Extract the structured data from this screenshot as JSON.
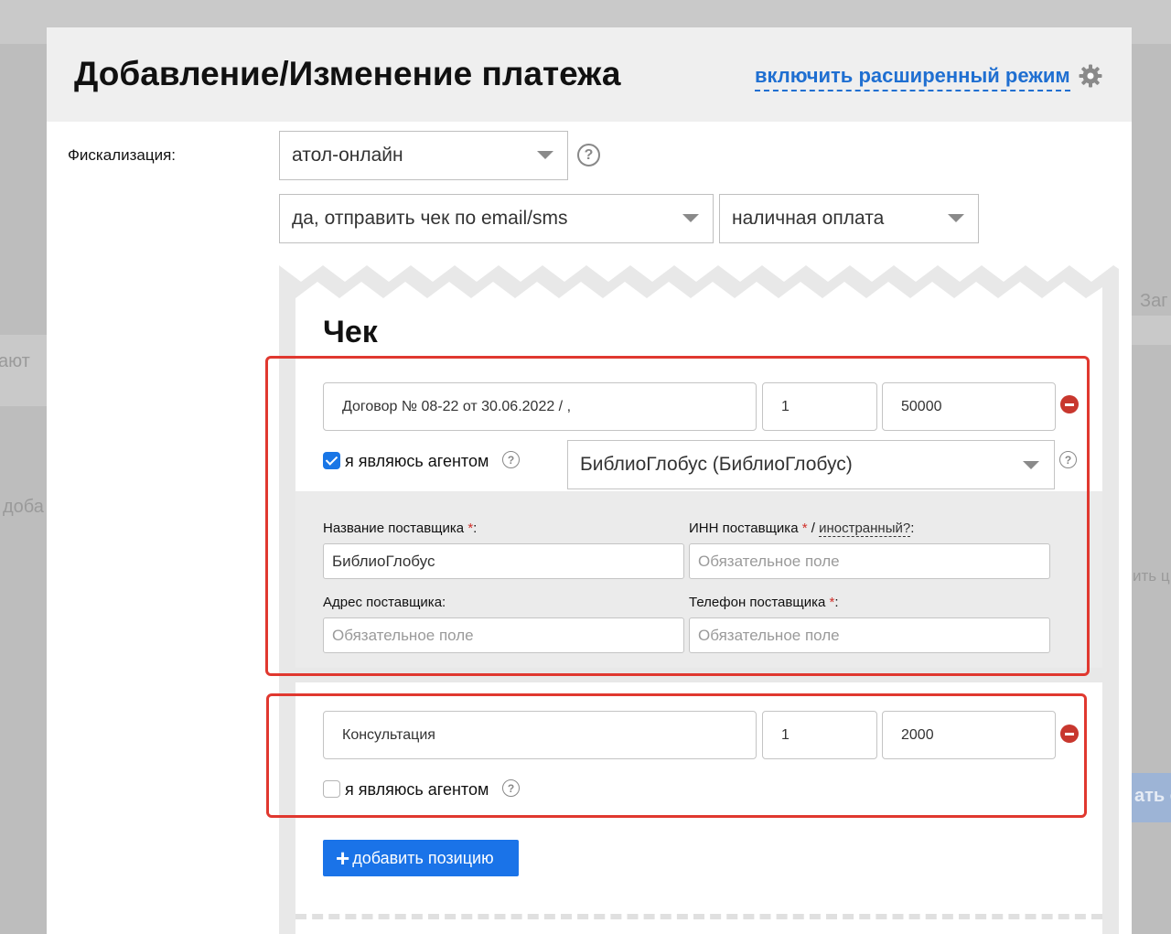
{
  "background": {
    "left_text_1": "ают",
    "left_text_2": "доба",
    "right_text_1": "Заг",
    "right_text_2": "ить ц",
    "right_button": "ать с"
  },
  "modal": {
    "title": "Добавление/Изменение платежа",
    "advanced_mode_link": "включить расширенный режим"
  },
  "fiscal": {
    "label": "Фискализация:",
    "provider_selected": "атол-онлайн",
    "send_receipt_selected": "да, отправить чек по email/sms",
    "payment_type_selected": "наличная оплата",
    "help_mark": "?"
  },
  "receipt": {
    "title": "Чек",
    "positions": [
      {
        "name": "Договор № 08-22 от 30.06.2022 / ,",
        "quantity": "1",
        "price": "50000",
        "agent_label": "я являюсь агентом",
        "agent_checked": true,
        "supplier_selected": "БиблиоГлобус (БиблиоГлобус)"
      },
      {
        "name": "Консультация",
        "quantity": "1",
        "price": "2000",
        "agent_label": "я являюсь агентом",
        "agent_checked": false
      }
    ],
    "supplier_form": {
      "name_label": "Название поставщика ",
      "name_value": "БиблиоГлобус",
      "inn_label": "ИНН поставщика ",
      "inn_slash": " / ",
      "inn_foreign": "иностранный?",
      "inn_colon": ":",
      "inn_placeholder": "Обязательное поле",
      "address_label": "Адрес поставщика:",
      "address_placeholder": "Обязательное поле",
      "phone_label": "Телефон поставщика ",
      "phone_placeholder": "Обязательное поле",
      "required_mark": "*",
      "label_colon": ":"
    },
    "add_position_button": "добавить позицию",
    "add_position_plus": "+"
  },
  "colors": {
    "accent_blue": "#1a73e8",
    "link_blue": "#1f6fd1",
    "remove_red": "#c8372e",
    "highlight_red": "#e0382f"
  },
  "icons": {
    "settings": "gear-icon",
    "help": "question-circle-icon",
    "remove": "minus-circle-icon",
    "dropdown": "chevron-down-icon"
  }
}
